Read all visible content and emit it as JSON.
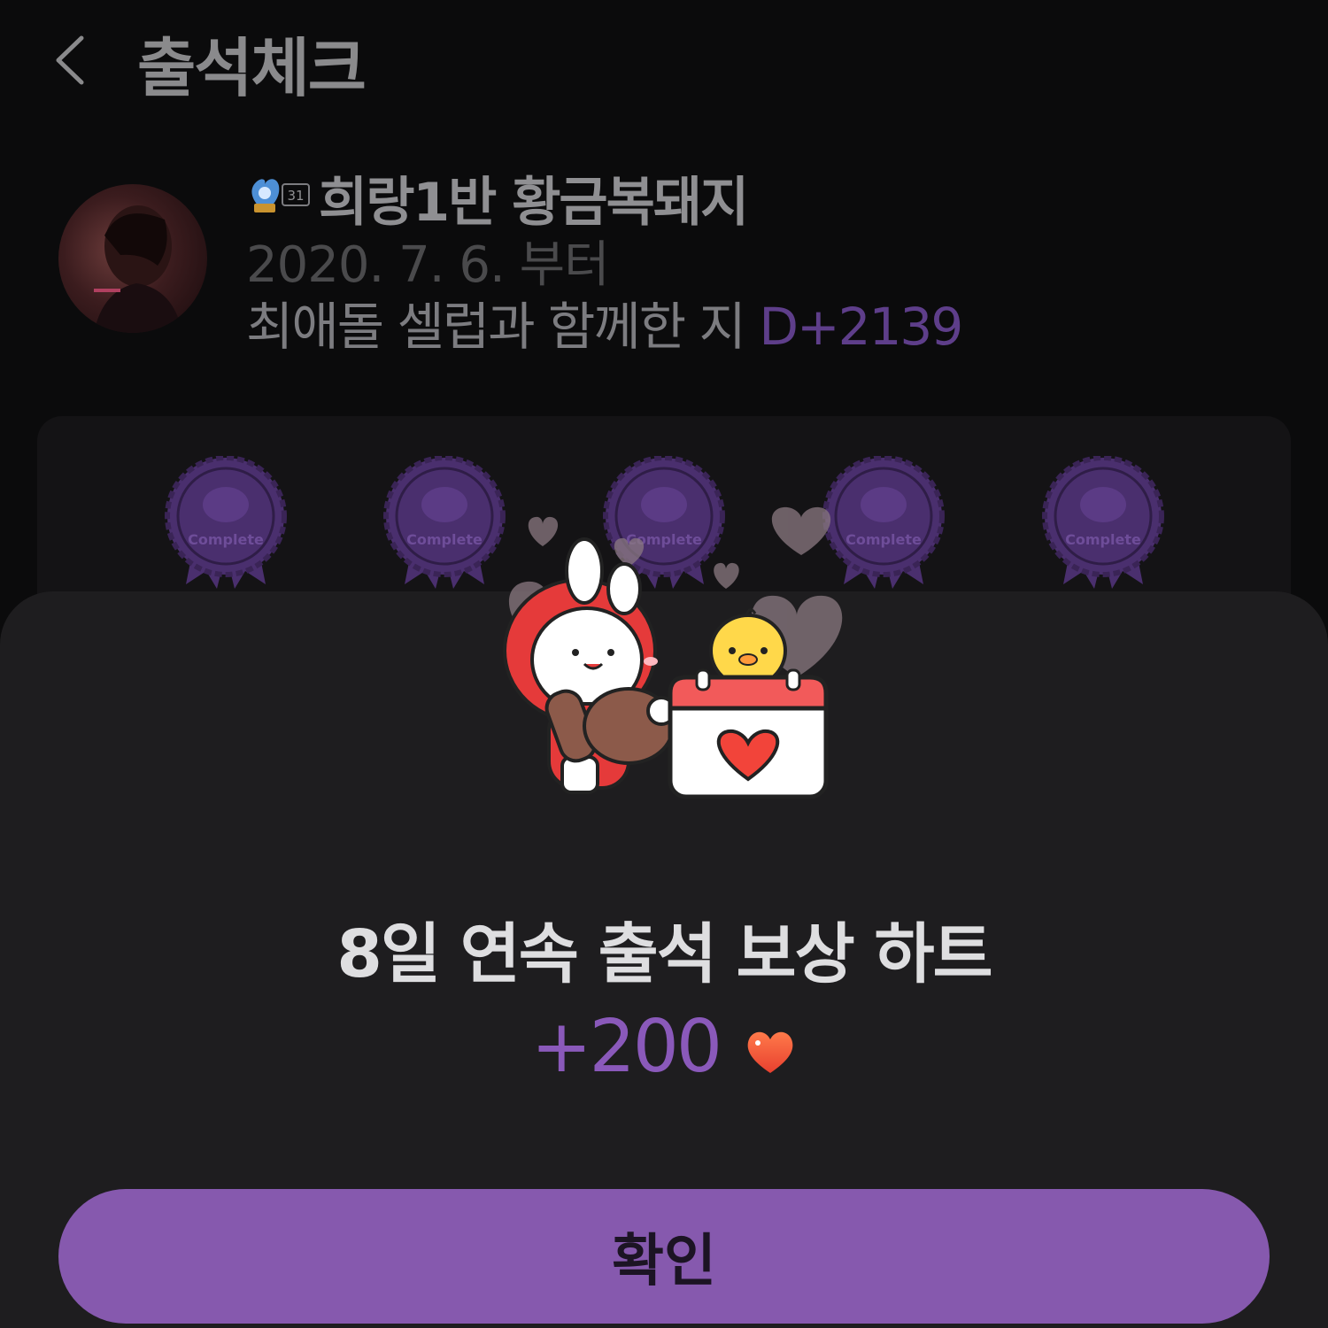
{
  "header": {
    "title": "출석체크",
    "back_icon": "chevron-left-icon"
  },
  "profile": {
    "badge_level": "31",
    "name": "희랑1반 황금복돼지",
    "since": "2020. 7. 6. 부터",
    "dday_prefix": "최애돌 셀럽과 함께한 지",
    "dday_value": "D+2139"
  },
  "stamps": [
    "Complete",
    "Complete",
    "Complete",
    "Complete",
    "Complete"
  ],
  "reward": {
    "title": "8일 연속 출석 보상 하트",
    "amount": "+200",
    "icon": "heart-icon"
  },
  "confirm_label": "확인",
  "colors": {
    "accent": "#8659ae",
    "amount": "#8a59ba",
    "stamp": "#4a2f6e"
  }
}
